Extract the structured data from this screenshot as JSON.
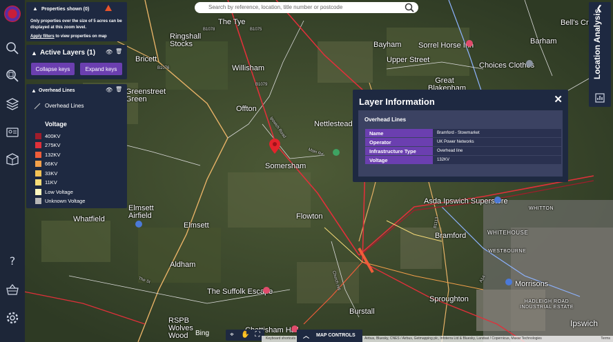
{
  "search": {
    "placeholder": "Search by reference, location, title number or postcode"
  },
  "properties": {
    "title": "Properties shown (0)",
    "info": "Only properties over the size of 5 acres can be displayed at this zoom level.",
    "link_label": "Apply filters",
    "link_suffix": "to view properties on map"
  },
  "active_layers": {
    "title": "Active Layers (1)",
    "collapse_label": "Collapse keys",
    "expand_label": "Expand keys"
  },
  "overhead_lines_layer": {
    "title": "Overhead Lines",
    "line_label": "Overhead Lines",
    "voltage_title": "Voltage",
    "legend": [
      {
        "label": "400KV",
        "color": "#a01d2b"
      },
      {
        "label": "275KV",
        "color": "#e0303a"
      },
      {
        "label": "132KV",
        "color": "#f05d3a"
      },
      {
        "label": "66KV",
        "color": "#f3a04a"
      },
      {
        "label": "33KV",
        "color": "#f4c255"
      },
      {
        "label": "11KV",
        "color": "#f7dc78"
      },
      {
        "label": "Low Voltage",
        "color": "#fdf6bf"
      },
      {
        "label": "Unknown Voltage",
        "color": "#b6b6b6"
      }
    ]
  },
  "layer_info": {
    "title": "Layer Information",
    "subtitle": "Overhead Lines",
    "rows": [
      {
        "key": "Name",
        "value": "Bramford - Stowmarket"
      },
      {
        "key": "Operator",
        "value": "UK Power Networks"
      },
      {
        "key": "Infrastructure Type",
        "value": "Overhead line"
      },
      {
        "key": "Voltage",
        "value": "132KV"
      }
    ]
  },
  "location_tab": {
    "label": "Location Analysis"
  },
  "map_controls": {
    "label": "MAP CONTROLS"
  },
  "keyboard_shortcuts": "Keyboard shortcuts",
  "attribution": "Airbus, Bluesky, CNES / Airbus, Getmapping plc, Infoterra Ltd & Bluesky, Landsat / Copernicus, Maxar Technologies",
  "terms": "Terms",
  "bing": "Bing",
  "places": [
    {
      "label": "The Tye"
    },
    {
      "label": "Ringshall Stocks"
    },
    {
      "label": "Willisham"
    },
    {
      "label": "Bayham"
    },
    {
      "label": "Sorrel Horse Inn"
    },
    {
      "label": "Upper Street"
    },
    {
      "label": "Great Blakenham"
    },
    {
      "label": "Barham"
    },
    {
      "label": "Bell's Cross"
    },
    {
      "label": "Choices Clothes"
    },
    {
      "label": "Offton"
    },
    {
      "label": "Nettlestead"
    },
    {
      "label": "Somersham"
    },
    {
      "label": "Greenstreet Green"
    },
    {
      "label": "Elmsett Airfield"
    },
    {
      "label": "Whatfield"
    },
    {
      "label": "Elmsett"
    },
    {
      "label": "Flowton"
    },
    {
      "label": "Asda Ipswich Superstore"
    },
    {
      "label": "WHITTON"
    },
    {
      "label": "Bramford"
    },
    {
      "label": "WHITEHOUSE"
    },
    {
      "label": "WESTBOURNE"
    },
    {
      "label": "Aldham"
    },
    {
      "label": "The Suffolk Escape"
    },
    {
      "label": "Morrisons"
    },
    {
      "label": "Sproughton"
    },
    {
      "label": "Burstall"
    },
    {
      "label": "HADLEIGH ROAD INDUSTRIAL ESTATE"
    },
    {
      "label": "Ipswich"
    },
    {
      "label": "RSPB Wolves Wood"
    },
    {
      "label": "Chattisham Hall"
    },
    {
      "label": "Bricett"
    }
  ],
  "roads": [
    "B1078",
    "B1075",
    "B1079",
    "B1076",
    "Ipswich Road",
    "Main Rd",
    "The St",
    "Church Hill",
    "A14",
    "B1113"
  ]
}
